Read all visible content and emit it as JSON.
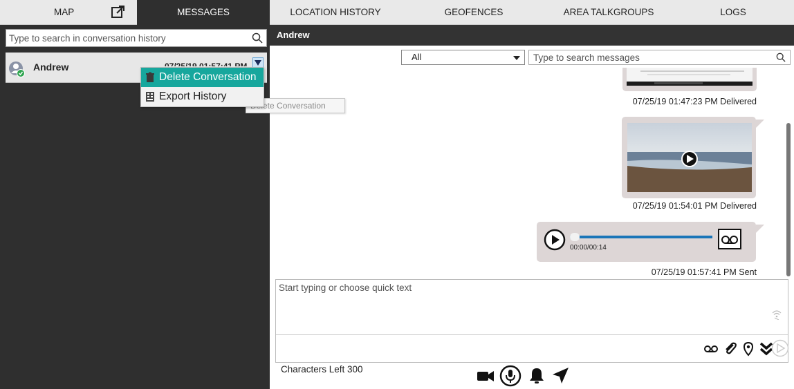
{
  "nav": {
    "tabs": [
      {
        "label": "MAP"
      },
      {
        "label": "MESSAGES"
      },
      {
        "label": "LOCATION HISTORY"
      },
      {
        "label": "GEOFENCES"
      },
      {
        "label": "AREA TALKGROUPS"
      },
      {
        "label": "LOGS"
      }
    ],
    "active_tab": "MESSAGES"
  },
  "left": {
    "search_placeholder": "Type to search in conversation history",
    "conversations": [
      {
        "name": "Andrew",
        "time": "07/25/19 01:57:41 PM",
        "status": "online"
      }
    ],
    "context_menu": [
      {
        "label": "Delete Conversation",
        "icon": "trash-icon",
        "highlighted": true
      },
      {
        "label": "Export History",
        "icon": "export-icon",
        "highlighted": false
      }
    ],
    "tooltip": "Delete Conversation"
  },
  "right": {
    "header": "Andrew",
    "filter_value": "All",
    "search_placeholder": "Type to search messages",
    "messages": [
      {
        "type": "image",
        "timestamp": "07/25/19 01:47:23 PM Delivered"
      },
      {
        "type": "video",
        "timestamp": "07/25/19 01:54:01 PM Delivered"
      },
      {
        "type": "audio",
        "time_display": "00:00/00:14",
        "timestamp": "07/25/19 01:57:41 PM Sent"
      }
    ],
    "compose_placeholder": "Start typing or choose quick text",
    "chars_left": "Characters Left 300"
  },
  "colors": {
    "dark": "#2f2f2f",
    "highlight": "#17a79d",
    "bubble": "#ddd6d6",
    "progress": "#1a75b8"
  }
}
